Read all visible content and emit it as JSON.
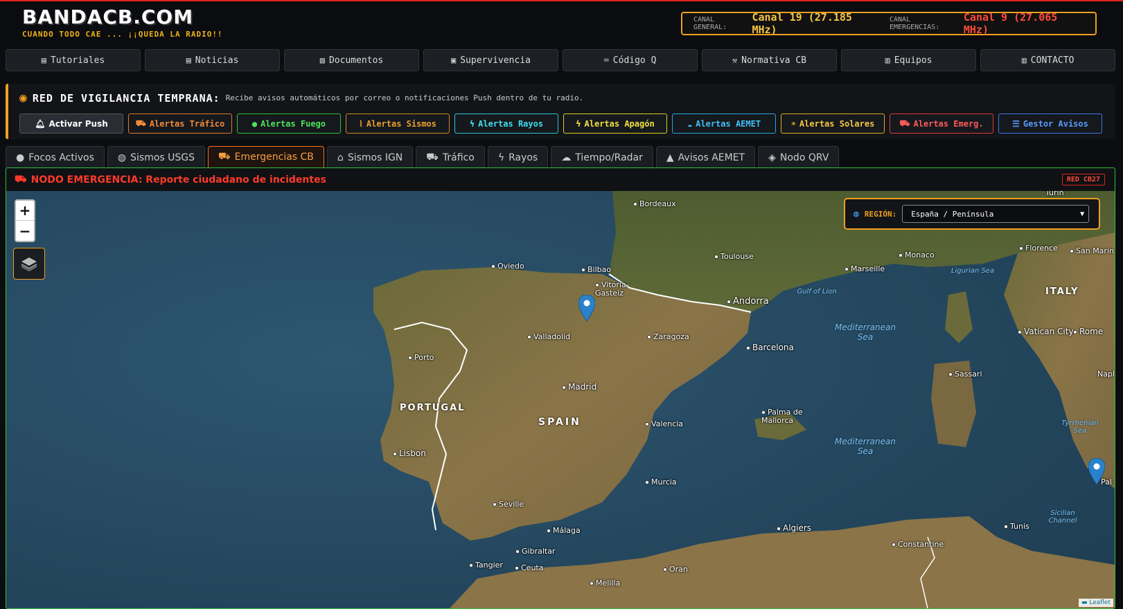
{
  "header": {
    "title": "BANDACB.COM",
    "tagline": "CUANDO TODO CAE ... ¡¡QUEDA LA RADIO!!",
    "canal_general_label": "CANAL GENERAL:",
    "canal_general_value": "Canal 19 (27.185 MHz)",
    "canal_emergencias_label": "CANAL EMERGENCIAS:",
    "canal_emergencias_value": "Canal 9 (27.065 MHz)"
  },
  "nav": {
    "items": [
      {
        "label": "Tutoriales",
        "icon": "book-icon"
      },
      {
        "label": "Noticias",
        "icon": "newspaper-icon"
      },
      {
        "label": "Documentos",
        "icon": "file-icon"
      },
      {
        "label": "Supervivencia",
        "icon": "box-icon"
      },
      {
        "label": "Código Q",
        "icon": "keyboard-icon"
      },
      {
        "label": "Normativa CB",
        "icon": "gavel-icon"
      },
      {
        "label": "Equipos",
        "icon": "radio-icon"
      },
      {
        "label": "CONTACTO",
        "icon": "mail-icon"
      }
    ]
  },
  "alerts": {
    "title": "RED DE VIGILANCIA TEMPRANA:",
    "description": "Recibe avisos automáticos por correo o notificaciones Push dentro de tu radio.",
    "push_label": "Activar Push",
    "buttons": [
      {
        "label": "Alertas Tráfico"
      },
      {
        "label": "Alertas Fuego"
      },
      {
        "label": "Alertas Sismos"
      },
      {
        "label": "Alertas Rayos"
      },
      {
        "label": "Alertas Apagón"
      },
      {
        "label": "Alertas AEMET"
      },
      {
        "label": "Alertas Solares"
      },
      {
        "label": "Alertas Emerg."
      },
      {
        "label": "Gestor Avisos"
      }
    ]
  },
  "tabs": [
    {
      "label": "Focos Activos"
    },
    {
      "label": "Sismos USGS"
    },
    {
      "label": "Emergencias CB",
      "active": true
    },
    {
      "label": "Sismos IGN"
    },
    {
      "label": "Tráfico"
    },
    {
      "label": "Rayos"
    },
    {
      "label": "Tiempo/Radar"
    },
    {
      "label": "Avisos AEMET"
    },
    {
      "label": "Nodo QRV"
    }
  ],
  "panel": {
    "title": "NODO EMERGENCIA: Reporte ciudadano de incidentes",
    "badge": "RED CB27"
  },
  "map": {
    "zoom_in": "+",
    "zoom_out": "−",
    "region_label": "REGIÓN:",
    "region_value": "España / Península",
    "attribution": "Leaflet",
    "countries": [
      "PORTUGAL",
      "SPAIN",
      "ITALY"
    ],
    "places": [
      "Bordeaux",
      "Toulouse",
      "Monaco",
      "Florence",
      "San Marin",
      "Oviedo",
      "Bilbao",
      "Vitoria-Gasteiz",
      "Andorra",
      "Marseille",
      "Valladolid",
      "Zaragoza",
      "Barcelona",
      "Porto",
      "Madrid",
      "Vatican City",
      "Rome",
      "Sassari",
      "Napl",
      "Palma de Mallorca",
      "Valencia",
      "Lisbon",
      "Murcia",
      "Seville",
      "Málaga",
      "Gibraltar",
      "Tangier",
      "Ceuta",
      "Algiers",
      "Tunis",
      "Constantine",
      "Oran",
      "Melilla",
      "Turin",
      "Pal"
    ],
    "seas": [
      "Mediterranean Sea",
      "Mediterranean Sea",
      "Ligurian Sea",
      "Gulf of Lion",
      "Tyrrhenian Sea",
      "Sicilian Channel"
    ]
  },
  "colors": {
    "accent": "#f0a020",
    "emergency": "#ff3a2a",
    "panel_border": "#2ec23a"
  }
}
